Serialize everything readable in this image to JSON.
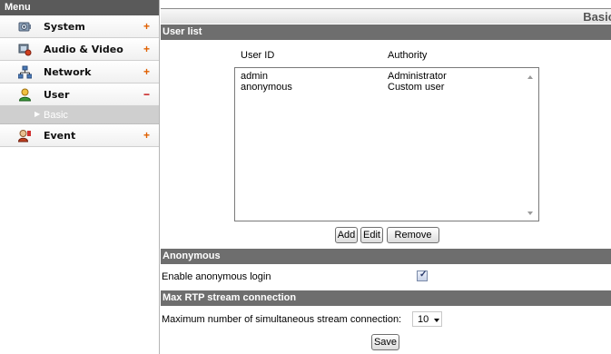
{
  "sidebar": {
    "header": "Menu",
    "items": [
      {
        "label": "System",
        "toggle": "+"
      },
      {
        "label": "Audio & Video",
        "toggle": "+"
      },
      {
        "label": "Network",
        "toggle": "+"
      },
      {
        "label": "User",
        "toggle": "−"
      },
      {
        "label": "Event",
        "toggle": "+"
      }
    ],
    "sub_items": [
      {
        "label": "Basic"
      }
    ]
  },
  "main": {
    "page_title": "Basic",
    "user_list": {
      "section_title": "User list",
      "columns": [
        "User ID",
        "Authority"
      ],
      "rows": [
        {
          "user_id": "admin",
          "authority": "Administrator"
        },
        {
          "user_id": "anonymous",
          "authority": "Custom user"
        }
      ],
      "buttons": {
        "add": "Add",
        "edit": "Edit",
        "remove": "Remove"
      }
    },
    "anonymous": {
      "section_title": "Anonymous",
      "label": "Enable anonymous login",
      "checked": true
    },
    "rtp": {
      "section_title": "Max RTP stream connection",
      "label": "Maximum number of simultaneous stream connection:",
      "value": "10"
    },
    "save_label": "Save"
  },
  "colors": {
    "section_header_bg": "#6e6e6e",
    "menu_header_bg": "#5a5a5a",
    "toggle_plus": "#e06000",
    "toggle_minus": "#c00000",
    "submenu_bg": "#cfcfcf"
  }
}
